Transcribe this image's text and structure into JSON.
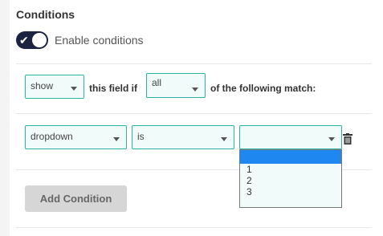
{
  "conditions": {
    "title": "Conditions",
    "enable_toggle": {
      "label": "Enable conditions",
      "on": true
    },
    "rule": {
      "action": "show",
      "middle_text": "this field if",
      "match_mode": "all",
      "tail_text": "of the following match:"
    },
    "condition_row": {
      "field": "dropdown",
      "operator": "is",
      "value": "",
      "value_options": [
        "",
        "1",
        "2",
        "3"
      ]
    },
    "add_condition_label": "Add Condition"
  },
  "colors": {
    "accent": "#2bb3a3",
    "toggle_bg": "#1c2340",
    "highlight": "#1e88f0"
  }
}
